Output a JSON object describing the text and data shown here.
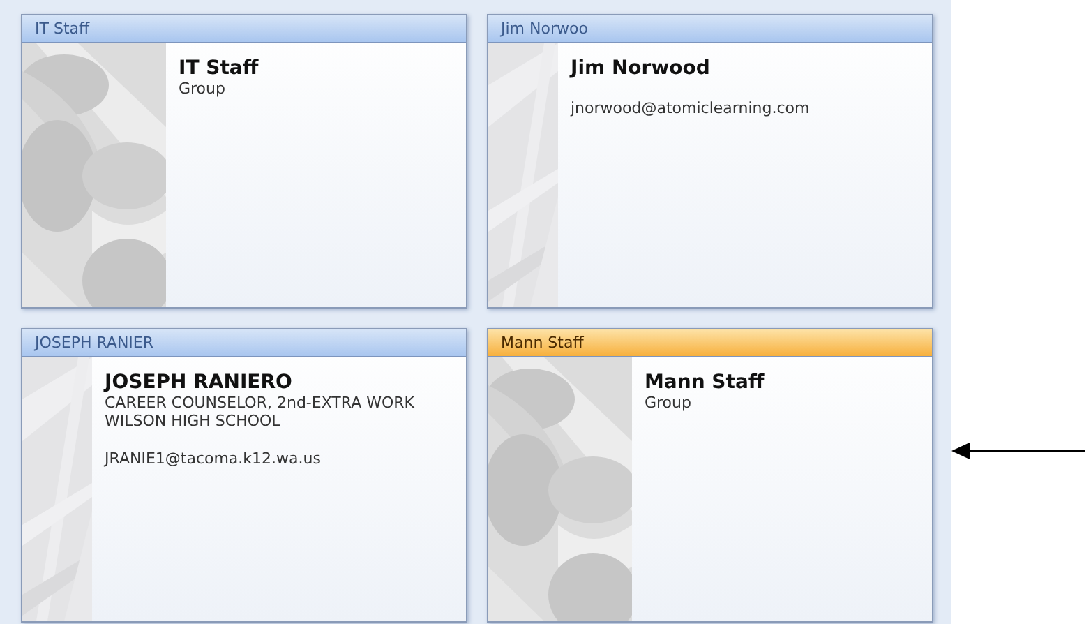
{
  "cards": [
    {
      "header": "IT Staff",
      "kind": "group",
      "selected": false,
      "name": "IT Staff",
      "lines": [
        {
          "kind": "info",
          "text": "Group"
        }
      ]
    },
    {
      "header": "Jim Norwoo",
      "kind": "contact",
      "selected": false,
      "name": "Jim Norwood",
      "lines": [
        {
          "kind": "email",
          "text": "jnorwood@atomiclearning.com"
        }
      ]
    },
    {
      "header": "JOSEPH RANIER",
      "kind": "contact",
      "selected": false,
      "name": "JOSEPH RANIERO",
      "lines": [
        {
          "kind": "info",
          "text": "CAREER COUNSELOR, 2nd-EXTRA WORK"
        },
        {
          "kind": "info",
          "text": "WILSON HIGH SCHOOL"
        },
        {
          "kind": "email",
          "text": "JRANIE1@tacoma.k12.wa.us"
        }
      ]
    },
    {
      "header": "Mann Staff",
      "kind": "group",
      "selected": true,
      "name": "Mann Staff",
      "lines": [
        {
          "kind": "info",
          "text": "Group"
        }
      ]
    }
  ]
}
